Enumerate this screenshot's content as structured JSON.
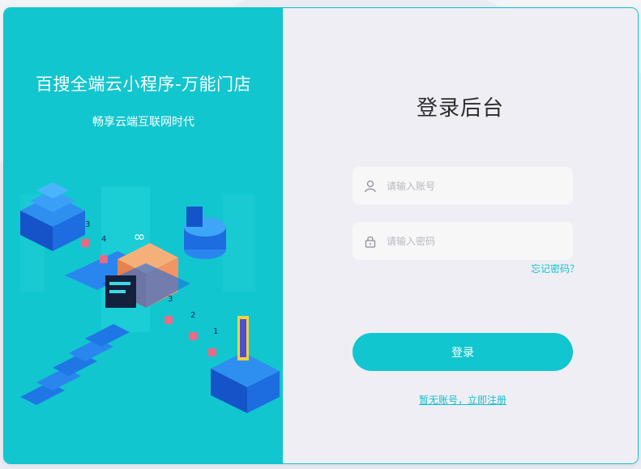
{
  "brand": {
    "title": "百搜全端云小程序-万能门店",
    "subtitle": "畅享云端互联网时代"
  },
  "login": {
    "title": "登录后台",
    "username_placeholder": "请输入账号",
    "password_placeholder": "请输入密码",
    "forgot_label": "忘记密码？",
    "submit_label": "登录",
    "register_label": "暂无账号，立即注册"
  },
  "illustration": {
    "block_labels": [
      "3",
      "4",
      "3",
      "2",
      "1"
    ],
    "core_symbol": "∞"
  },
  "colors": {
    "accent": "#12c6cf",
    "panel_bg": "#efeef5",
    "input_bg": "#f7f7f8",
    "page_bg": "#e9ecf2"
  },
  "icons": {
    "username": "user-icon",
    "password": "lock-icon"
  }
}
